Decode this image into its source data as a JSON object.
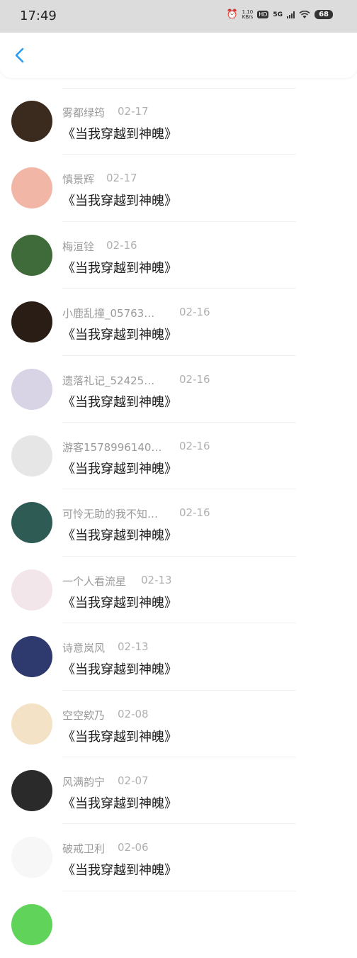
{
  "status_bar": {
    "time": "17:49",
    "net_speed_top": "1.10",
    "net_speed_bottom": "KB/s",
    "hd": "HD",
    "network": "5G",
    "battery": "68",
    "icons": [
      "alarm-icon",
      "hd-icon",
      "signal-icon",
      "wifi-icon",
      "battery-icon"
    ]
  },
  "header": {
    "back_icon": "chevron-left-icon",
    "accent": "#2b9bf4"
  },
  "comments": [
    {
      "name": "雾都绿筠",
      "date": "02-17",
      "book": "《当我穿越到神魄》",
      "avatar_color": "#3b2a1e"
    },
    {
      "name": "慎景辉",
      "date": "02-17",
      "book": "《当我穿越到神魄》",
      "avatar_color": "#f2b6a6"
    },
    {
      "name": "梅洹铨",
      "date": "02-16",
      "book": "《当我穿越到神魄》",
      "avatar_color": "#3f6a3a"
    },
    {
      "name": "小鹿乱撞_05763…",
      "date": "02-16",
      "book": "《当我穿越到神魄》",
      "avatar_color": "#2a1d16"
    },
    {
      "name": "遗落礼记_52425…",
      "date": "02-16",
      "book": "《当我穿越到神魄》",
      "avatar_color": "#d8d4e6"
    },
    {
      "name": "游客1578996140…",
      "date": "02-16",
      "book": "《当我穿越到神魄》",
      "avatar_color": "#e6e6e6"
    },
    {
      "name": "可怜无助的我不知…",
      "date": "02-16",
      "book": "《当我穿越到神魄》",
      "avatar_color": "#2f5b55"
    },
    {
      "name": "一个人看流星",
      "date": "02-13",
      "book": "《当我穿越到神魄》",
      "avatar_color": "#f3e6ea"
    },
    {
      "name": "诗意岚风",
      "date": "02-13",
      "book": "《当我穿越到神魄》",
      "avatar_color": "#2e3a6e"
    },
    {
      "name": "空空欸乃",
      "date": "02-08",
      "book": "《当我穿越到神魄》",
      "avatar_color": "#f4e2c6"
    },
    {
      "name": "风满韵宁",
      "date": "02-07",
      "book": "《当我穿越到神魄》",
      "avatar_color": "#2a2a2a"
    },
    {
      "name": "破戒卫利",
      "date": "02-06",
      "book": "《当我穿越到神魄》",
      "avatar_color": "#f7f7f7"
    }
  ]
}
